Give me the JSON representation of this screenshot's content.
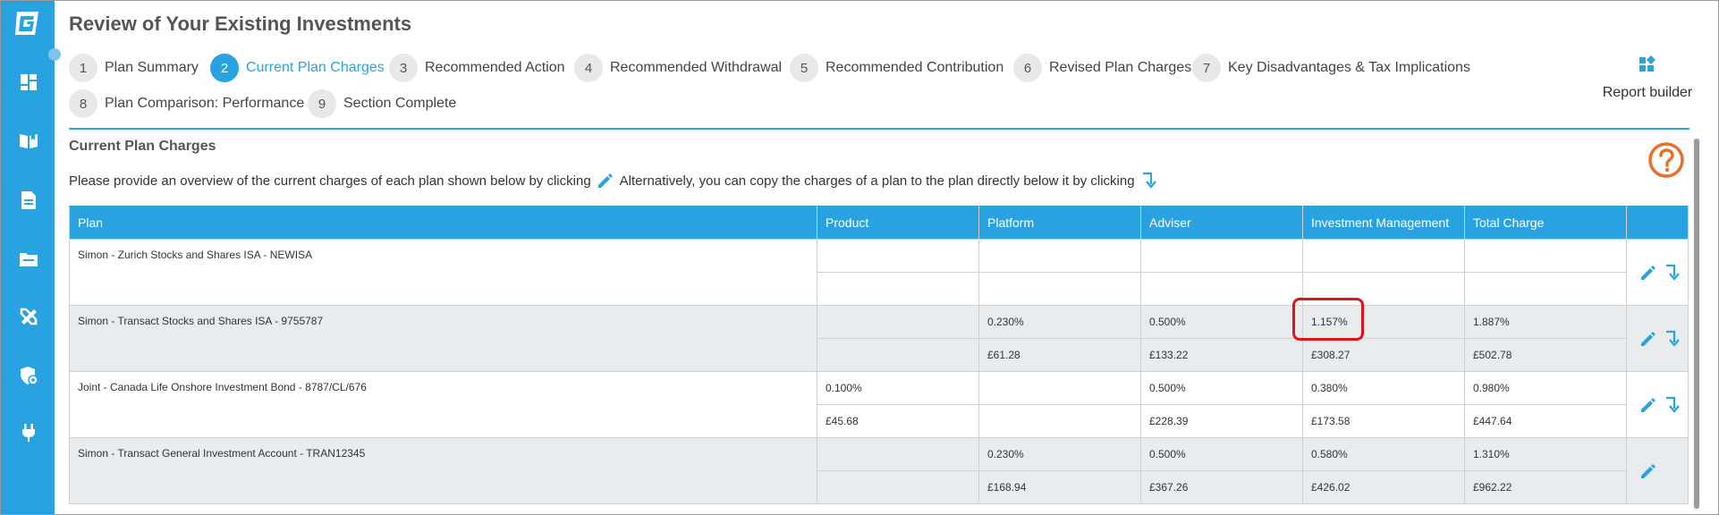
{
  "page": {
    "title": "Review of Your Existing Investments"
  },
  "steps": [
    {
      "number": "1",
      "label": "Plan Summary",
      "active": false
    },
    {
      "number": "2",
      "label": "Current Plan Charges",
      "active": true
    },
    {
      "number": "3",
      "label": "Recommended Action",
      "active": false
    },
    {
      "number": "4",
      "label": "Recommended Withdrawal",
      "active": false
    },
    {
      "number": "5",
      "label": "Recommended Contribution",
      "active": false
    },
    {
      "number": "6",
      "label": "Revised Plan Charges",
      "active": false
    },
    {
      "number": "7",
      "label": "Key Disadvantages & Tax Implications",
      "active": false
    },
    {
      "number": "8",
      "label": "Plan Comparison: Performance",
      "active": false
    },
    {
      "number": "9",
      "label": "Section Complete",
      "active": false
    }
  ],
  "report_builder": {
    "label": "Report builder",
    "icon": "report-builder-icon"
  },
  "section": {
    "title": "Current Plan Charges",
    "instructions_part1": "Please provide an overview of the current charges of each plan shown below by clicking",
    "instructions_part2": "Alternatively, you can copy the charges of a plan to the plan directly below it by clicking"
  },
  "table": {
    "headers": {
      "plan": "Plan",
      "product": "Product",
      "platform": "Platform",
      "adviser": "Adviser",
      "investment_management": "Investment Management",
      "total_charge": "Total Charge"
    },
    "rows": [
      {
        "plan": "Simon - Zurich Stocks and Shares ISA - NEWISA",
        "product_pct": "",
        "platform_pct": "",
        "adviser_pct": "",
        "im_pct": "",
        "total_pct": "",
        "product_amt": "",
        "platform_amt": "",
        "adviser_amt": "",
        "im_amt": "",
        "total_amt": ""
      },
      {
        "plan": "Simon - Transact Stocks and Shares ISA - 9755787",
        "product_pct": "",
        "platform_pct": "0.230%",
        "adviser_pct": "0.500%",
        "im_pct": "1.157%",
        "total_pct": "1.887%",
        "product_amt": "",
        "platform_amt": "£61.28",
        "adviser_amt": "£133.22",
        "im_amt": "£308.27",
        "total_amt": "£502.78"
      },
      {
        "plan": "Joint - Canada Life Onshore Investment Bond - 8787/CL/676",
        "product_pct": "0.100%",
        "platform_pct": "",
        "adviser_pct": "0.500%",
        "im_pct": "0.380%",
        "total_pct": "0.980%",
        "product_amt": "£45.68",
        "platform_amt": "",
        "adviser_amt": "£228.39",
        "im_amt": "£173.58",
        "total_amt": "£447.64"
      },
      {
        "plan": "Simon - Transact General Investment Account - TRAN12345",
        "product_pct": "",
        "platform_pct": "0.230%",
        "adviser_pct": "0.500%",
        "im_pct": "0.580%",
        "total_pct": "1.310%",
        "product_amt": "",
        "platform_amt": "£168.94",
        "adviser_amt": "£367.26",
        "im_amt": "£426.02",
        "total_amt": "£962.22"
      }
    ]
  },
  "colors": {
    "accent": "#29a3e0",
    "help": "#e8702a",
    "highlight": "#e2121c",
    "row_alt": "#e9ecef"
  },
  "sidebar_icons": [
    "logo-icon",
    "dashboard-icon",
    "book-icon",
    "document-icon",
    "folder-icon",
    "tools-icon",
    "shield-icon",
    "plug-icon"
  ]
}
